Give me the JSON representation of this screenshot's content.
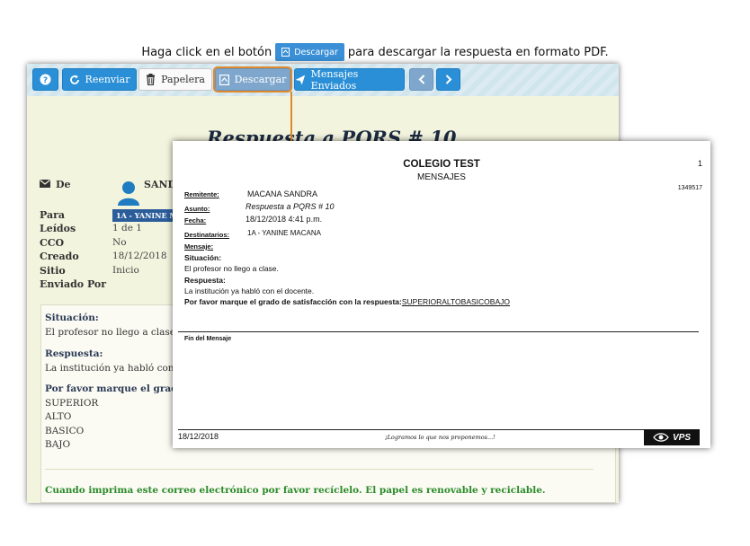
{
  "instruction": {
    "prefix": "Haga click en el botón",
    "button_label": "Descargar",
    "suffix": "para descargar la respuesta en formato PDF."
  },
  "toolbar": {
    "help_icon": "question-icon",
    "resend_label": "Reenviar",
    "trash_label": "Papelera",
    "download_label": "Descargar",
    "sent_label": "Mensajes Enviados"
  },
  "panel": {
    "title": "Respuesta a PQRS # 10",
    "from_label": "De",
    "from_name": "SANDR",
    "fields": [
      {
        "label": "Para",
        "value": ""
      },
      {
        "label": "Leídos",
        "value": "1 de 1"
      },
      {
        "label": "CCO",
        "value": "No"
      },
      {
        "label": "Creado",
        "value": "18/12/2018"
      },
      {
        "label": "Sitio",
        "value": "Inicio"
      },
      {
        "label": "Enviado Por",
        "value": ""
      }
    ],
    "to_tag": "1A - YANINE MA",
    "body": {
      "situation_label": "Situación:",
      "situation_text": "El profesor no llego a clase.",
      "response_label": "Respuesta:",
      "response_text": "La institución ya habló con el",
      "survey_label": "Por favor marque el grado d",
      "options": [
        "SUPERIOR",
        "ALTO",
        "BASICO",
        "BAJO"
      ],
      "footer": "Cuando imprima este correo electrónico por favor recíclelo. El papel es renovable y reciclable."
    }
  },
  "pdf": {
    "title": "COLEGIO TEST",
    "subtitle": "MENSAJES",
    "page_number": "1",
    "ref_number": "1349517",
    "sender_label": "Remitente:",
    "sender_value": "MACANA SANDRA",
    "subject_label": "Asunto:",
    "subject_value": "Respuesta a PQRS # 10",
    "date_label": "Fecha:",
    "date_value": "18/12/2018   4:41 p.m.",
    "recipients_label": "Destinatarios:",
    "recipients_value": "1A - YANINE MACANA",
    "message_label": "Mensaje:",
    "situation_label": "Situación:",
    "situation_text": "El profesor no llego a clase.",
    "response_label": "Respuesta:",
    "response_text": "La institución ya habló con el docente.",
    "survey_label": "Por favor marque el grado de satisfacción con la respuesta:",
    "survey_options": "SUPERIORALTOBASICOBAJO",
    "end_label": "Fin del Mensaje",
    "footer_date": "18/12/2018",
    "footer_motto": "¡Logramos lo que nos proponemos...!",
    "logo_text": "VPS"
  },
  "colors": {
    "accent_blue": "#2a8fd6",
    "highlight_orange": "#e0882a",
    "panel_bg": "#f3f4de",
    "footer_green": "#2a8a2a"
  }
}
